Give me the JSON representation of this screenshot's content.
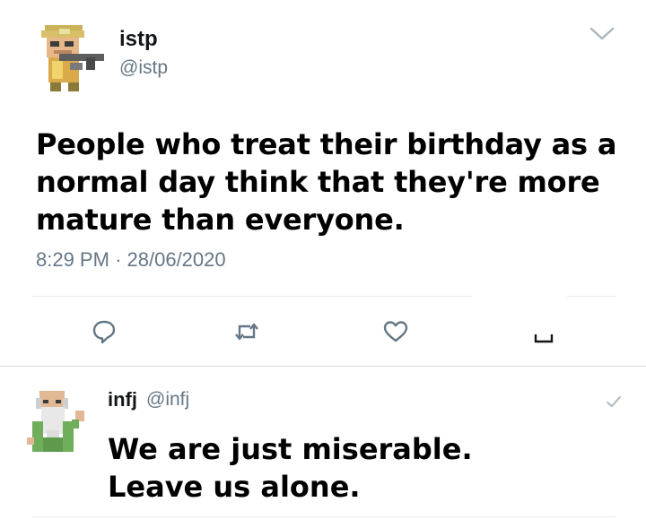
{
  "main_tweet": {
    "display_name": "istp",
    "handle": "@istp",
    "text": "People who treat their birthday as a normal day think that they're more mature than everyone.",
    "time": "8:29 PM",
    "separator": "·",
    "date": "28/06/2020",
    "menu_icon": "chevron-down-icon",
    "avatar_icon": "pixel-soldier-avatar"
  },
  "actions": [
    {
      "name": "reply-button",
      "icon": "comment-icon"
    },
    {
      "name": "retweet-button",
      "icon": "retweet-icon"
    },
    {
      "name": "like-button",
      "icon": "heart-icon"
    },
    {
      "name": "share-button",
      "icon": "share-icon"
    }
  ],
  "reply_tweet": {
    "display_name": "infj",
    "handle": "@infj",
    "text_line1": "We are just miserable.",
    "text_line2": "Leave us alone.",
    "menu_icon": "chevron-down-icon",
    "avatar_icon": "pixel-wizard-avatar"
  },
  "colors": {
    "text": "#14171a",
    "secondary": "#657786",
    "icon": "#657786",
    "divider": "#e6ecf0"
  }
}
